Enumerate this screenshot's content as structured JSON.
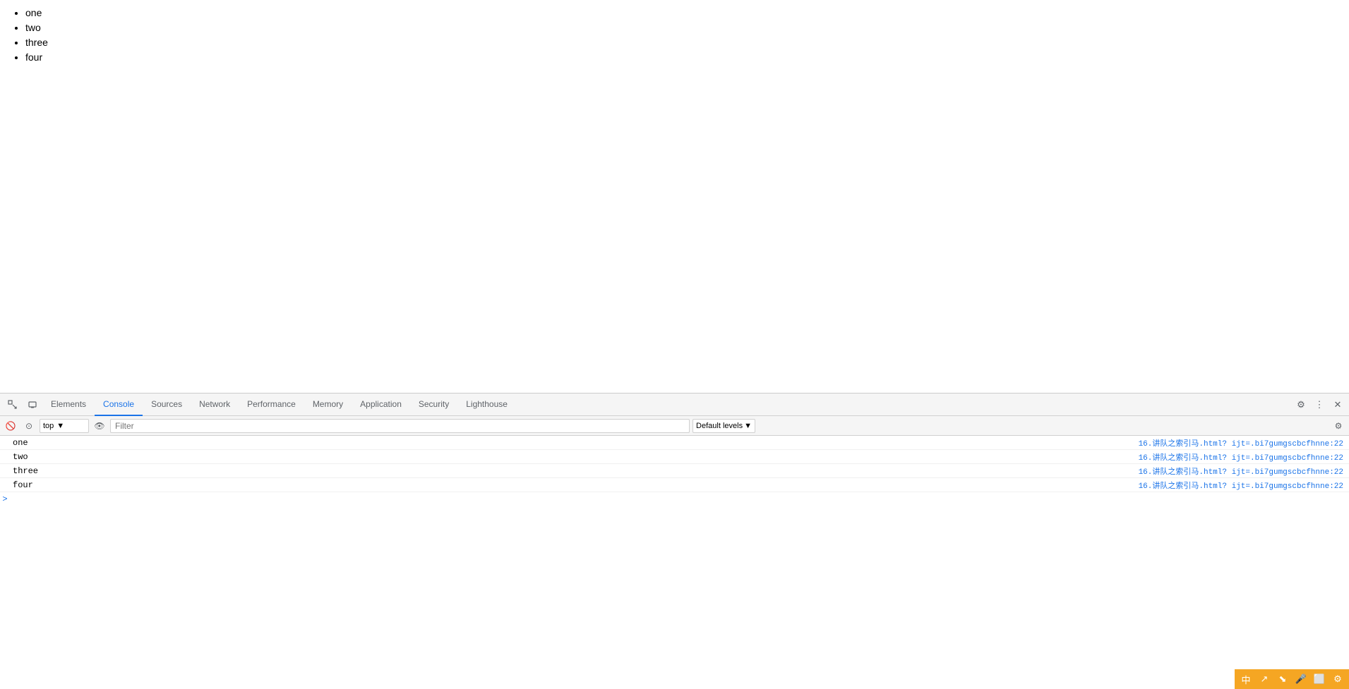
{
  "page": {
    "list_items": [
      "one",
      "two",
      "three",
      "four"
    ]
  },
  "devtools": {
    "tabs": [
      {
        "label": "Elements",
        "active": false
      },
      {
        "label": "Console",
        "active": true
      },
      {
        "label": "Sources",
        "active": false
      },
      {
        "label": "Network",
        "active": false
      },
      {
        "label": "Performance",
        "active": false
      },
      {
        "label": "Memory",
        "active": false
      },
      {
        "label": "Application",
        "active": false
      },
      {
        "label": "Security",
        "active": false
      },
      {
        "label": "Lighthouse",
        "active": false
      }
    ],
    "console": {
      "context": "top",
      "filter_placeholder": "Filter",
      "default_levels": "Default levels",
      "rows": [
        {
          "text": "one",
          "link": "16.讲队之索引马.html? ijt=.bi7gumgscbcfhnne:22"
        },
        {
          "text": "two",
          "link": "16.讲队之索引马.html? ijt=.bi7gumgscbcfhnne:22"
        },
        {
          "text": "three",
          "link": "16.讲队之索引马.html? ijt=.bi7gumgscbcfhnne:22"
        },
        {
          "text": "four",
          "link": "16.讲队之索引马.html? ijt=.bi7gumgscbcfhnne:22"
        }
      ]
    }
  },
  "statusbar": {
    "icons": [
      "中",
      "↗",
      "⬊",
      "🎤",
      "⬜",
      "⚙"
    ]
  }
}
